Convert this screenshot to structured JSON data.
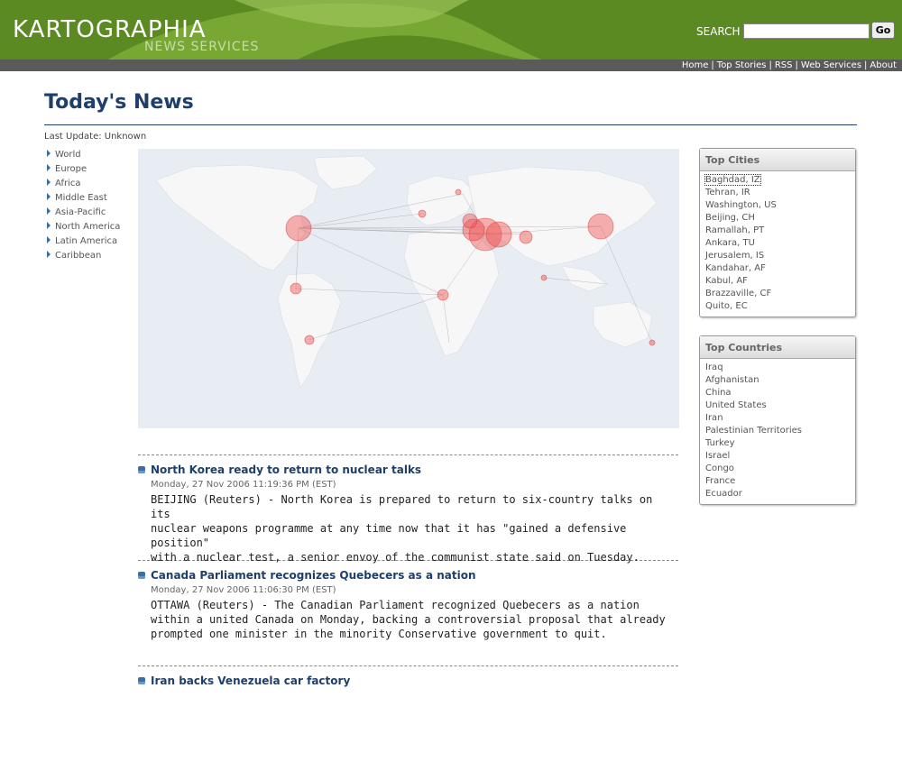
{
  "header": {
    "logo_text": "KARTOGRAPHIA",
    "logo_sub": "NEWS SERVICES",
    "search_label": "SEARCH",
    "search_value": "",
    "go_label": "Go",
    "nav_links": [
      "Home",
      "Top Stories",
      "RSS",
      "Web Services",
      "About"
    ]
  },
  "page": {
    "title": "Today's News",
    "last_update": "Last Update: Unknown"
  },
  "regions": [
    "World",
    "Europe",
    "Africa",
    "Middle East",
    "Asia-Pacific",
    "North America",
    "Latin America",
    "Caribbean"
  ],
  "top_cities": {
    "header": "Top Cities",
    "items": [
      "Baghdad, IZ",
      "Tehran, IR",
      "Washington, US",
      "Beijing, CH",
      "Ramallah, PT",
      "Ankara, TU",
      "Jerusalem, IS",
      "Kandahar, AF",
      "Kabul, AF",
      "Brazzaville, CF",
      "Quito, EC"
    ]
  },
  "top_countries": {
    "header": "Top Countries",
    "items": [
      "Iraq",
      "Afghanistan",
      "China",
      "United States",
      "Iran",
      "Palestinian Territories",
      "Turkey",
      "Israel",
      "Congo",
      "France",
      "Ecuador"
    ]
  },
  "news": [
    {
      "title": "North Korea ready to return to nuclear talks",
      "date": "Monday, 27 Nov 2006 11:19:36 PM (EST)",
      "body": "BEIJING (Reuters) - North Korea is prepared to return to six-country talks on its\nnuclear weapons programme at any time now that it has \"gained a defensive position\"\nwith a nuclear test, a senior envoy of the communist state said on Tuesday."
    },
    {
      "title": "Canada Parliament recognizes Quebecers as a nation",
      "date": "Monday, 27 Nov 2006 11:06:30 PM (EST)",
      "body": "OTTAWA (Reuters) - The Canadian Parliament recognized Quebecers as a nation\nwithin a united Canada on Monday, backing a controversial proposal that already\nprompted one minister in the minority Conservative government to quit."
    },
    {
      "title": "Iran backs Venezuela car factory",
      "date": "",
      "body": ""
    }
  ],
  "colors": {
    "header_green": "#5b8a22",
    "navbar_gray": "#5a5a5a",
    "title_blue": "#1f3f6b",
    "marker_red": "#f05050"
  }
}
